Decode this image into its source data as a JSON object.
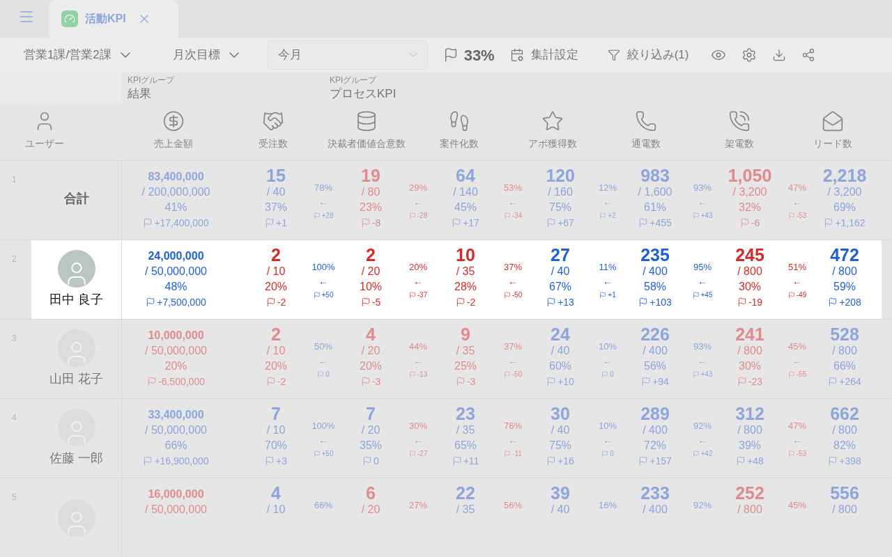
{
  "tab_bar": {
    "tabs": [
      {
        "label": "活動KPI",
        "selected": true
      }
    ]
  },
  "toolbar": {
    "team": "営業1課/営業2課",
    "target": "月次目標",
    "period": "今月",
    "achievement": "33%",
    "settings": "集計設定",
    "filter": "絞り込み(1)"
  },
  "kpi_groups": [
    {
      "caption": "KPIグループ",
      "name": "結果"
    },
    {
      "caption": "KPIグループ",
      "name": "プロセスKPI"
    }
  ],
  "columns": [
    "ユーザー",
    "売上金額",
    "受注数",
    "決裁者価値合意数",
    "案件化数",
    "アポ獲得数",
    "通電数",
    "架電数",
    "リード数"
  ],
  "rows": [
    {
      "number": "1",
      "kind": "total",
      "label": "合計",
      "highlighted": false,
      "cells": [
        {
          "kind": "amount",
          "achieved": true,
          "value": "83,400,000",
          "target": "/ 200,000,000",
          "rate": "41%",
          "diff": "+17,400,000"
        },
        {
          "kind": "metric",
          "achieved": true,
          "value": "15",
          "target": "/ 40",
          "rate": "37%",
          "diff": "+1"
        },
        {
          "kind": "conversion",
          "achieved": true,
          "rate": "78%",
          "arrow": "←",
          "diff": "+28"
        },
        {
          "kind": "metric",
          "achieved": false,
          "value": "19",
          "target": "/ 80",
          "rate": "23%",
          "diff": "-8"
        },
        {
          "kind": "conversion",
          "achieved": false,
          "rate": "29%",
          "arrow": "←",
          "diff": "-28"
        },
        {
          "kind": "metric",
          "achieved": true,
          "value": "64",
          "target": "/ 140",
          "rate": "45%",
          "diff": "+17"
        },
        {
          "kind": "conversion",
          "achieved": false,
          "rate": "53%",
          "arrow": "←",
          "diff": "-34"
        },
        {
          "kind": "metric",
          "achieved": true,
          "value": "120",
          "target": "/ 160",
          "rate": "75%",
          "diff": "+67"
        },
        {
          "kind": "conversion",
          "achieved": true,
          "rate": "12%",
          "arrow": "←",
          "diff": "+2"
        },
        {
          "kind": "metric",
          "achieved": true,
          "value": "983",
          "target": "/ 1,600",
          "rate": "61%",
          "diff": "+455"
        },
        {
          "kind": "conversion",
          "achieved": true,
          "rate": "93%",
          "arrow": "←",
          "diff": "+43"
        },
        {
          "kind": "metric",
          "achieved": false,
          "value": "1,050",
          "target": "/ 3,200",
          "rate": "32%",
          "diff": "-6"
        },
        {
          "kind": "conversion",
          "achieved": false,
          "rate": "47%",
          "arrow": "←",
          "diff": "-53"
        },
        {
          "kind": "metric",
          "achieved": true,
          "value": "2,218",
          "target": "/ 3,200",
          "rate": "69%",
          "diff": "+1,162"
        }
      ]
    },
    {
      "number": "2",
      "kind": "user",
      "label": "田中 良子",
      "highlighted": true,
      "cells": [
        {
          "kind": "amount",
          "achieved": true,
          "value": "24,000,000",
          "target": "/ 50,000,000",
          "rate": "48%",
          "diff": "+7,500,000"
        },
        {
          "kind": "metric",
          "achieved": false,
          "value": "2",
          "target": "/ 10",
          "rate": "20%",
          "diff": "-2"
        },
        {
          "kind": "conversion",
          "achieved": true,
          "rate": "100%",
          "arrow": "←",
          "diff": "+50"
        },
        {
          "kind": "metric",
          "achieved": false,
          "value": "2",
          "target": "/ 20",
          "rate": "10%",
          "diff": "-5"
        },
        {
          "kind": "conversion",
          "achieved": false,
          "rate": "20%",
          "arrow": "←",
          "diff": "-37"
        },
        {
          "kind": "metric",
          "achieved": false,
          "value": "10",
          "target": "/ 35",
          "rate": "28%",
          "diff": "-2"
        },
        {
          "kind": "conversion",
          "achieved": false,
          "rate": "37%",
          "arrow": "←",
          "diff": "-50"
        },
        {
          "kind": "metric",
          "achieved": true,
          "value": "27",
          "target": "/ 40",
          "rate": "67%",
          "diff": "+13"
        },
        {
          "kind": "conversion",
          "achieved": true,
          "rate": "11%",
          "arrow": "←",
          "diff": "+1"
        },
        {
          "kind": "metric",
          "achieved": true,
          "value": "235",
          "target": "/ 400",
          "rate": "58%",
          "diff": "+103"
        },
        {
          "kind": "conversion",
          "achieved": true,
          "rate": "95%",
          "arrow": "←",
          "diff": "+45"
        },
        {
          "kind": "metric",
          "achieved": false,
          "value": "245",
          "target": "/ 800",
          "rate": "30%",
          "diff": "-19"
        },
        {
          "kind": "conversion",
          "achieved": false,
          "rate": "51%",
          "arrow": "←",
          "diff": "-49"
        },
        {
          "kind": "metric",
          "achieved": true,
          "value": "472",
          "target": "/ 800",
          "rate": "59%",
          "diff": "+208"
        }
      ]
    },
    {
      "number": "3",
      "kind": "user",
      "label": "山田 花子",
      "highlighted": false,
      "cells": [
        {
          "kind": "amount",
          "achieved": false,
          "value": "10,000,000",
          "target": "/ 50,000,000",
          "rate": "20%",
          "diff": "-6,500,000"
        },
        {
          "kind": "metric",
          "achieved": false,
          "value": "2",
          "target": "/ 10",
          "rate": "20%",
          "diff": "-2"
        },
        {
          "kind": "conversion",
          "achieved": true,
          "rate": "50%",
          "arrow": "←",
          "diff": "0"
        },
        {
          "kind": "metric",
          "achieved": false,
          "value": "4",
          "target": "/ 20",
          "rate": "20%",
          "diff": "-3"
        },
        {
          "kind": "conversion",
          "achieved": false,
          "rate": "44%",
          "arrow": "←",
          "diff": "-13"
        },
        {
          "kind": "metric",
          "achieved": false,
          "value": "9",
          "target": "/ 35",
          "rate": "25%",
          "diff": "-3"
        },
        {
          "kind": "conversion",
          "achieved": false,
          "rate": "37%",
          "arrow": "←",
          "diff": "-50"
        },
        {
          "kind": "metric",
          "achieved": true,
          "value": "24",
          "target": "/ 40",
          "rate": "60%",
          "diff": "+10"
        },
        {
          "kind": "conversion",
          "achieved": true,
          "rate": "10%",
          "arrow": "←",
          "diff": "0"
        },
        {
          "kind": "metric",
          "achieved": true,
          "value": "226",
          "target": "/ 400",
          "rate": "56%",
          "diff": "+94"
        },
        {
          "kind": "conversion",
          "achieved": true,
          "rate": "93%",
          "arrow": "←",
          "diff": "+43"
        },
        {
          "kind": "metric",
          "achieved": false,
          "value": "241",
          "target": "/ 800",
          "rate": "30%",
          "diff": "-23"
        },
        {
          "kind": "conversion",
          "achieved": false,
          "rate": "45%",
          "arrow": "←",
          "diff": "-55"
        },
        {
          "kind": "metric",
          "achieved": true,
          "value": "528",
          "target": "/ 800",
          "rate": "66%",
          "diff": "+264"
        }
      ]
    },
    {
      "number": "4",
      "kind": "user",
      "label": "佐藤 一郎",
      "highlighted": false,
      "cells": [
        {
          "kind": "amount",
          "achieved": true,
          "value": "33,400,000",
          "target": "/ 50,000,000",
          "rate": "66%",
          "diff": "+16,900,000"
        },
        {
          "kind": "metric",
          "achieved": true,
          "value": "7",
          "target": "/ 10",
          "rate": "70%",
          "diff": "+3"
        },
        {
          "kind": "conversion",
          "achieved": true,
          "rate": "100%",
          "arrow": "←",
          "diff": "+50"
        },
        {
          "kind": "metric",
          "achieved": true,
          "value": "7",
          "target": "/ 20",
          "rate": "35%",
          "diff": "0"
        },
        {
          "kind": "conversion",
          "achieved": false,
          "rate": "30%",
          "arrow": "←",
          "diff": "-27"
        },
        {
          "kind": "metric",
          "achieved": true,
          "value": "23",
          "target": "/ 35",
          "rate": "65%",
          "diff": "+11"
        },
        {
          "kind": "conversion",
          "achieved": false,
          "rate": "76%",
          "arrow": "←",
          "diff": "-11"
        },
        {
          "kind": "metric",
          "achieved": true,
          "value": "30",
          "target": "/ 40",
          "rate": "75%",
          "diff": "+16"
        },
        {
          "kind": "conversion",
          "achieved": true,
          "rate": "10%",
          "arrow": "←",
          "diff": "0"
        },
        {
          "kind": "metric",
          "achieved": true,
          "value": "289",
          "target": "/ 400",
          "rate": "72%",
          "diff": "+157"
        },
        {
          "kind": "conversion",
          "achieved": true,
          "rate": "92%",
          "arrow": "←",
          "diff": "+42"
        },
        {
          "kind": "metric",
          "achieved": true,
          "value": "312",
          "target": "/ 800",
          "rate": "39%",
          "diff": "+48"
        },
        {
          "kind": "conversion",
          "achieved": false,
          "rate": "47%",
          "arrow": "←",
          "diff": "-53"
        },
        {
          "kind": "metric",
          "achieved": true,
          "value": "662",
          "target": "/ 800",
          "rate": "82%",
          "diff": "+398"
        }
      ]
    },
    {
      "number": "5",
      "kind": "user",
      "highlighted": false,
      "cells": [
        {
          "kind": "amount",
          "achieved": false,
          "value": "16,000,000",
          "target": "/ 50,000,000"
        },
        {
          "kind": "metric",
          "achieved": true,
          "value": "4",
          "target": "/ 10"
        },
        {
          "kind": "conversion",
          "achieved": true,
          "rate": "66%"
        },
        {
          "kind": "metric",
          "achieved": false,
          "value": "6",
          "target": "/ 20"
        },
        {
          "kind": "conversion",
          "achieved": false,
          "rate": "27%"
        },
        {
          "kind": "metric",
          "achieved": true,
          "value": "22",
          "target": "/ 35"
        },
        {
          "kind": "conversion",
          "achieved": false,
          "rate": "56%"
        },
        {
          "kind": "metric",
          "achieved": true,
          "value": "39",
          "target": "/ 40"
        },
        {
          "kind": "conversion",
          "achieved": true,
          "rate": "16%"
        },
        {
          "kind": "metric",
          "achieved": true,
          "value": "233",
          "target": "/ 400"
        },
        {
          "kind": "conversion",
          "achieved": true,
          "rate": "92%"
        },
        {
          "kind": "metric",
          "achieved": false,
          "value": "252",
          "target": "/ 800"
        },
        {
          "kind": "conversion",
          "achieved": false,
          "rate": "45%"
        },
        {
          "kind": "metric",
          "achieved": true,
          "value": "556",
          "target": "/ 800"
        }
      ]
    }
  ]
}
